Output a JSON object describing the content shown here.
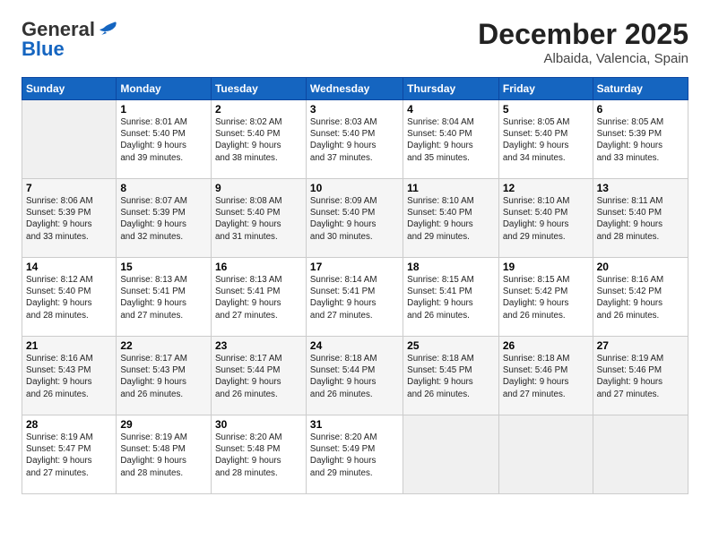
{
  "header": {
    "logo_general": "General",
    "logo_blue": "Blue",
    "title": "December 2025",
    "subtitle": "Albaida, Valencia, Spain"
  },
  "weekdays": [
    "Sunday",
    "Monday",
    "Tuesday",
    "Wednesday",
    "Thursday",
    "Friday",
    "Saturday"
  ],
  "weeks": [
    [
      {
        "day": "",
        "info": ""
      },
      {
        "day": "1",
        "info": "Sunrise: 8:01 AM\nSunset: 5:40 PM\nDaylight: 9 hours\nand 39 minutes."
      },
      {
        "day": "2",
        "info": "Sunrise: 8:02 AM\nSunset: 5:40 PM\nDaylight: 9 hours\nand 38 minutes."
      },
      {
        "day": "3",
        "info": "Sunrise: 8:03 AM\nSunset: 5:40 PM\nDaylight: 9 hours\nand 37 minutes."
      },
      {
        "day": "4",
        "info": "Sunrise: 8:04 AM\nSunset: 5:40 PM\nDaylight: 9 hours\nand 35 minutes."
      },
      {
        "day": "5",
        "info": "Sunrise: 8:05 AM\nSunset: 5:40 PM\nDaylight: 9 hours\nand 34 minutes."
      },
      {
        "day": "6",
        "info": "Sunrise: 8:05 AM\nSunset: 5:39 PM\nDaylight: 9 hours\nand 33 minutes."
      }
    ],
    [
      {
        "day": "7",
        "info": "Sunrise: 8:06 AM\nSunset: 5:39 PM\nDaylight: 9 hours\nand 33 minutes."
      },
      {
        "day": "8",
        "info": "Sunrise: 8:07 AM\nSunset: 5:39 PM\nDaylight: 9 hours\nand 32 minutes."
      },
      {
        "day": "9",
        "info": "Sunrise: 8:08 AM\nSunset: 5:40 PM\nDaylight: 9 hours\nand 31 minutes."
      },
      {
        "day": "10",
        "info": "Sunrise: 8:09 AM\nSunset: 5:40 PM\nDaylight: 9 hours\nand 30 minutes."
      },
      {
        "day": "11",
        "info": "Sunrise: 8:10 AM\nSunset: 5:40 PM\nDaylight: 9 hours\nand 29 minutes."
      },
      {
        "day": "12",
        "info": "Sunrise: 8:10 AM\nSunset: 5:40 PM\nDaylight: 9 hours\nand 29 minutes."
      },
      {
        "day": "13",
        "info": "Sunrise: 8:11 AM\nSunset: 5:40 PM\nDaylight: 9 hours\nand 28 minutes."
      }
    ],
    [
      {
        "day": "14",
        "info": "Sunrise: 8:12 AM\nSunset: 5:40 PM\nDaylight: 9 hours\nand 28 minutes."
      },
      {
        "day": "15",
        "info": "Sunrise: 8:13 AM\nSunset: 5:41 PM\nDaylight: 9 hours\nand 27 minutes."
      },
      {
        "day": "16",
        "info": "Sunrise: 8:13 AM\nSunset: 5:41 PM\nDaylight: 9 hours\nand 27 minutes."
      },
      {
        "day": "17",
        "info": "Sunrise: 8:14 AM\nSunset: 5:41 PM\nDaylight: 9 hours\nand 27 minutes."
      },
      {
        "day": "18",
        "info": "Sunrise: 8:15 AM\nSunset: 5:41 PM\nDaylight: 9 hours\nand 26 minutes."
      },
      {
        "day": "19",
        "info": "Sunrise: 8:15 AM\nSunset: 5:42 PM\nDaylight: 9 hours\nand 26 minutes."
      },
      {
        "day": "20",
        "info": "Sunrise: 8:16 AM\nSunset: 5:42 PM\nDaylight: 9 hours\nand 26 minutes."
      }
    ],
    [
      {
        "day": "21",
        "info": "Sunrise: 8:16 AM\nSunset: 5:43 PM\nDaylight: 9 hours\nand 26 minutes."
      },
      {
        "day": "22",
        "info": "Sunrise: 8:17 AM\nSunset: 5:43 PM\nDaylight: 9 hours\nand 26 minutes."
      },
      {
        "day": "23",
        "info": "Sunrise: 8:17 AM\nSunset: 5:44 PM\nDaylight: 9 hours\nand 26 minutes."
      },
      {
        "day": "24",
        "info": "Sunrise: 8:18 AM\nSunset: 5:44 PM\nDaylight: 9 hours\nand 26 minutes."
      },
      {
        "day": "25",
        "info": "Sunrise: 8:18 AM\nSunset: 5:45 PM\nDaylight: 9 hours\nand 26 minutes."
      },
      {
        "day": "26",
        "info": "Sunrise: 8:18 AM\nSunset: 5:46 PM\nDaylight: 9 hours\nand 27 minutes."
      },
      {
        "day": "27",
        "info": "Sunrise: 8:19 AM\nSunset: 5:46 PM\nDaylight: 9 hours\nand 27 minutes."
      }
    ],
    [
      {
        "day": "28",
        "info": "Sunrise: 8:19 AM\nSunset: 5:47 PM\nDaylight: 9 hours\nand 27 minutes."
      },
      {
        "day": "29",
        "info": "Sunrise: 8:19 AM\nSunset: 5:48 PM\nDaylight: 9 hours\nand 28 minutes."
      },
      {
        "day": "30",
        "info": "Sunrise: 8:20 AM\nSunset: 5:48 PM\nDaylight: 9 hours\nand 28 minutes."
      },
      {
        "day": "31",
        "info": "Sunrise: 8:20 AM\nSunset: 5:49 PM\nDaylight: 9 hours\nand 29 minutes."
      },
      {
        "day": "",
        "info": ""
      },
      {
        "day": "",
        "info": ""
      },
      {
        "day": "",
        "info": ""
      }
    ]
  ]
}
